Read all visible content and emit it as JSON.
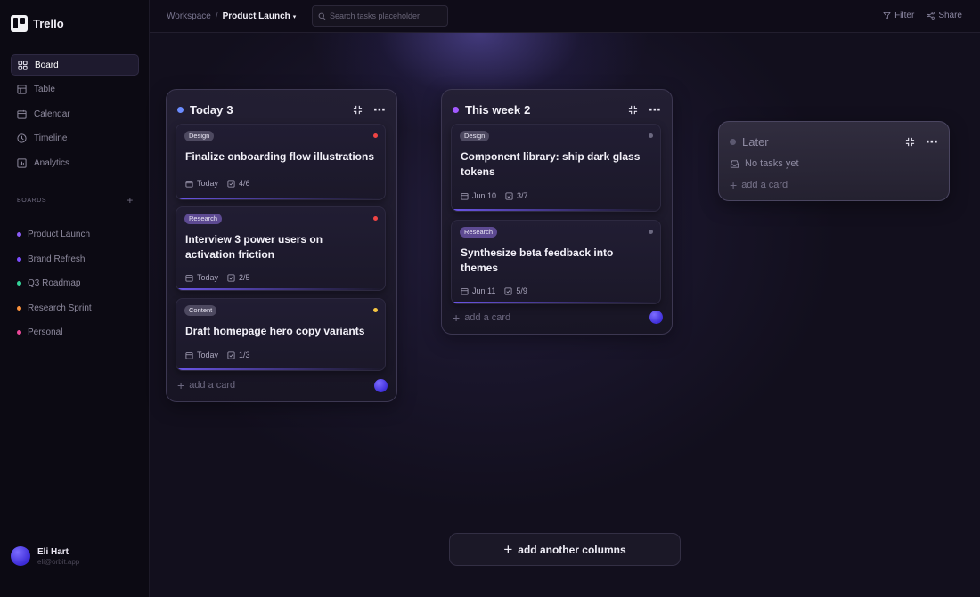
{
  "app": {
    "name": "Trello"
  },
  "sidebar": {
    "nav": [
      {
        "label": "Board",
        "icon": "board-icon",
        "active": true
      },
      {
        "label": "Table",
        "icon": "table-icon",
        "active": false
      },
      {
        "label": "Calendar",
        "icon": "calendar-icon",
        "active": false
      },
      {
        "label": "Timeline",
        "icon": "timeline-icon",
        "active": false
      },
      {
        "label": "Analytics",
        "icon": "analytics-icon",
        "active": false
      }
    ],
    "boards_heading": "BOARDS",
    "boards_add": "+",
    "boards": [
      {
        "label": "Product Launch",
        "color": "#8b5cf6"
      },
      {
        "label": "Brand Refresh",
        "color": "#7c4dff"
      },
      {
        "label": "Q3 Roadmap",
        "color": "#34d399"
      },
      {
        "label": "Research Sprint",
        "color": "#fb923c"
      },
      {
        "label": "Personal",
        "color": "#ec4899"
      }
    ],
    "user": {
      "name": "Eli Hart",
      "email": "eli@orbit.app"
    }
  },
  "topbar": {
    "breadcrumb_root": "Workspace",
    "breadcrumb_sep": "/",
    "breadcrumb_current": "Product Launch",
    "search_placeholder": "Search tasks placeholder",
    "filter_label": "Filter",
    "share_label": "Share"
  },
  "columns": [
    {
      "title": "Today",
      "count": "3",
      "color": "#6b8cff",
      "cards": [
        {
          "tag": "Design",
          "flag_color": "#ef4444",
          "title": "Finalize onboarding flow illustrations",
          "date": "Today",
          "checklist": "4/6"
        },
        {
          "tag": "Research",
          "flag_color": "#ef4444",
          "title": "Interview 3 power users on activation friction",
          "date": "Today",
          "checklist": "2/5"
        },
        {
          "tag": "Content",
          "flag_color": "#f5c542",
          "title": "Draft homepage hero copy variants",
          "date": "Today",
          "checklist": "1/3"
        }
      ],
      "add_label": "add a card"
    },
    {
      "title": "This week",
      "count": "2",
      "color": "#a259ff",
      "cards": [
        {
          "tag": "Design",
          "flag_color": "#6b6880",
          "title": "Component library: ship dark glass tokens",
          "date": "Jun 10",
          "checklist": "3/7"
        },
        {
          "tag": "Research",
          "flag_color": "#6b6880",
          "title": "Synthesize beta feedback into themes",
          "date": "Jun 11",
          "checklist": "5/9"
        }
      ],
      "add_label": "add a card"
    },
    {
      "title": "Later",
      "color": "#5c5970",
      "empty_label": "No tasks yet",
      "add_label": "add a card"
    }
  ],
  "add_column_label": "add another columns",
  "add_symbol": "+"
}
